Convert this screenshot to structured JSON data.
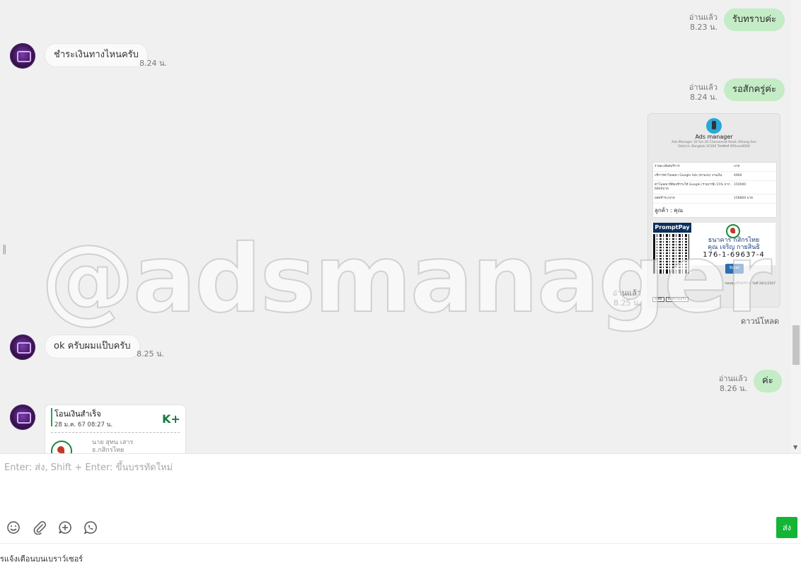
{
  "messages": {
    "m1": {
      "text": "รับทราบค่ะ",
      "status": "อ่านแล้ว",
      "time": "8.23 น."
    },
    "m2": {
      "text": "ชำระเงินทางไหนครับ",
      "time": "8.24 น."
    },
    "m3": {
      "text": "รอสักครู่ค่ะ",
      "status": "อ่านแล้ว",
      "time": "8.24 น."
    },
    "m4": {
      "status": "อ่านแล้ว",
      "time": "8.25 น.",
      "download": "ดาวน์โหลด"
    },
    "m5": {
      "text": "ok ครับผมแป๊บครับ",
      "time": "8.25 น."
    },
    "m6": {
      "text": "ค่ะ",
      "status": "อ่านแล้ว",
      "time": "8.26 น."
    }
  },
  "invoice": {
    "company": "Ads manager",
    "address": "Ads Manager 32 Soi 20 Charoenrat Road, Khlong San District, Bangkok 10160 โทรศัพท์ 095xxx0000",
    "header_item": "รายละเอียดบริการ",
    "header_amount": "บาท",
    "rows": [
      {
        "item": "บริการค่าโฆษณา Google Ads (ตามงบ) งานเงิน",
        "amount": "4900"
      },
      {
        "item": "ค่าโฆษณาที่ต้องชำระให้ Google (รวมภาษี) 15% จาก 6800บาท",
        "amount": "150000"
      }
    ],
    "total_label": "ยอดชำระ/บาท",
    "total_amount": "158800 บาท",
    "customer": "ลูกค้า : คุณ",
    "promptpay": "PromptPay",
    "bank_name": "ธนาคาร กสิกรไทย",
    "account_name": "คุณ เจริญ กายสินธิ",
    "account_number": "176-1-69637-4",
    "confirm_button": "ยืนยอด",
    "footer": "ขอบคุณที่ใช้บริการ วันที่ 28/1/2567",
    "footer_btn1": "ส่งต่อ",
    "footer_btn2": "บันทึกใบเสร็จ"
  },
  "transfer": {
    "title": "โอนเงินสำเร็จ",
    "date": "28 ม.ค. 67  08:27 น.",
    "brand": "K+",
    "sender": "นาย สุทน เสาร",
    "bank": "ธ.กสิกรไทย"
  },
  "watermark": "@adsmanager",
  "composer": {
    "placeholder": "Enter: ส่ง, Shift + Enter: ขึ้นบรรทัดใหม่",
    "send": "ส่ง"
  },
  "notice": "รแจ้งเตือนบนเบราว์เซอร์",
  "colors": {
    "outgoing": "#c4ecc6",
    "send": "#12b534"
  }
}
